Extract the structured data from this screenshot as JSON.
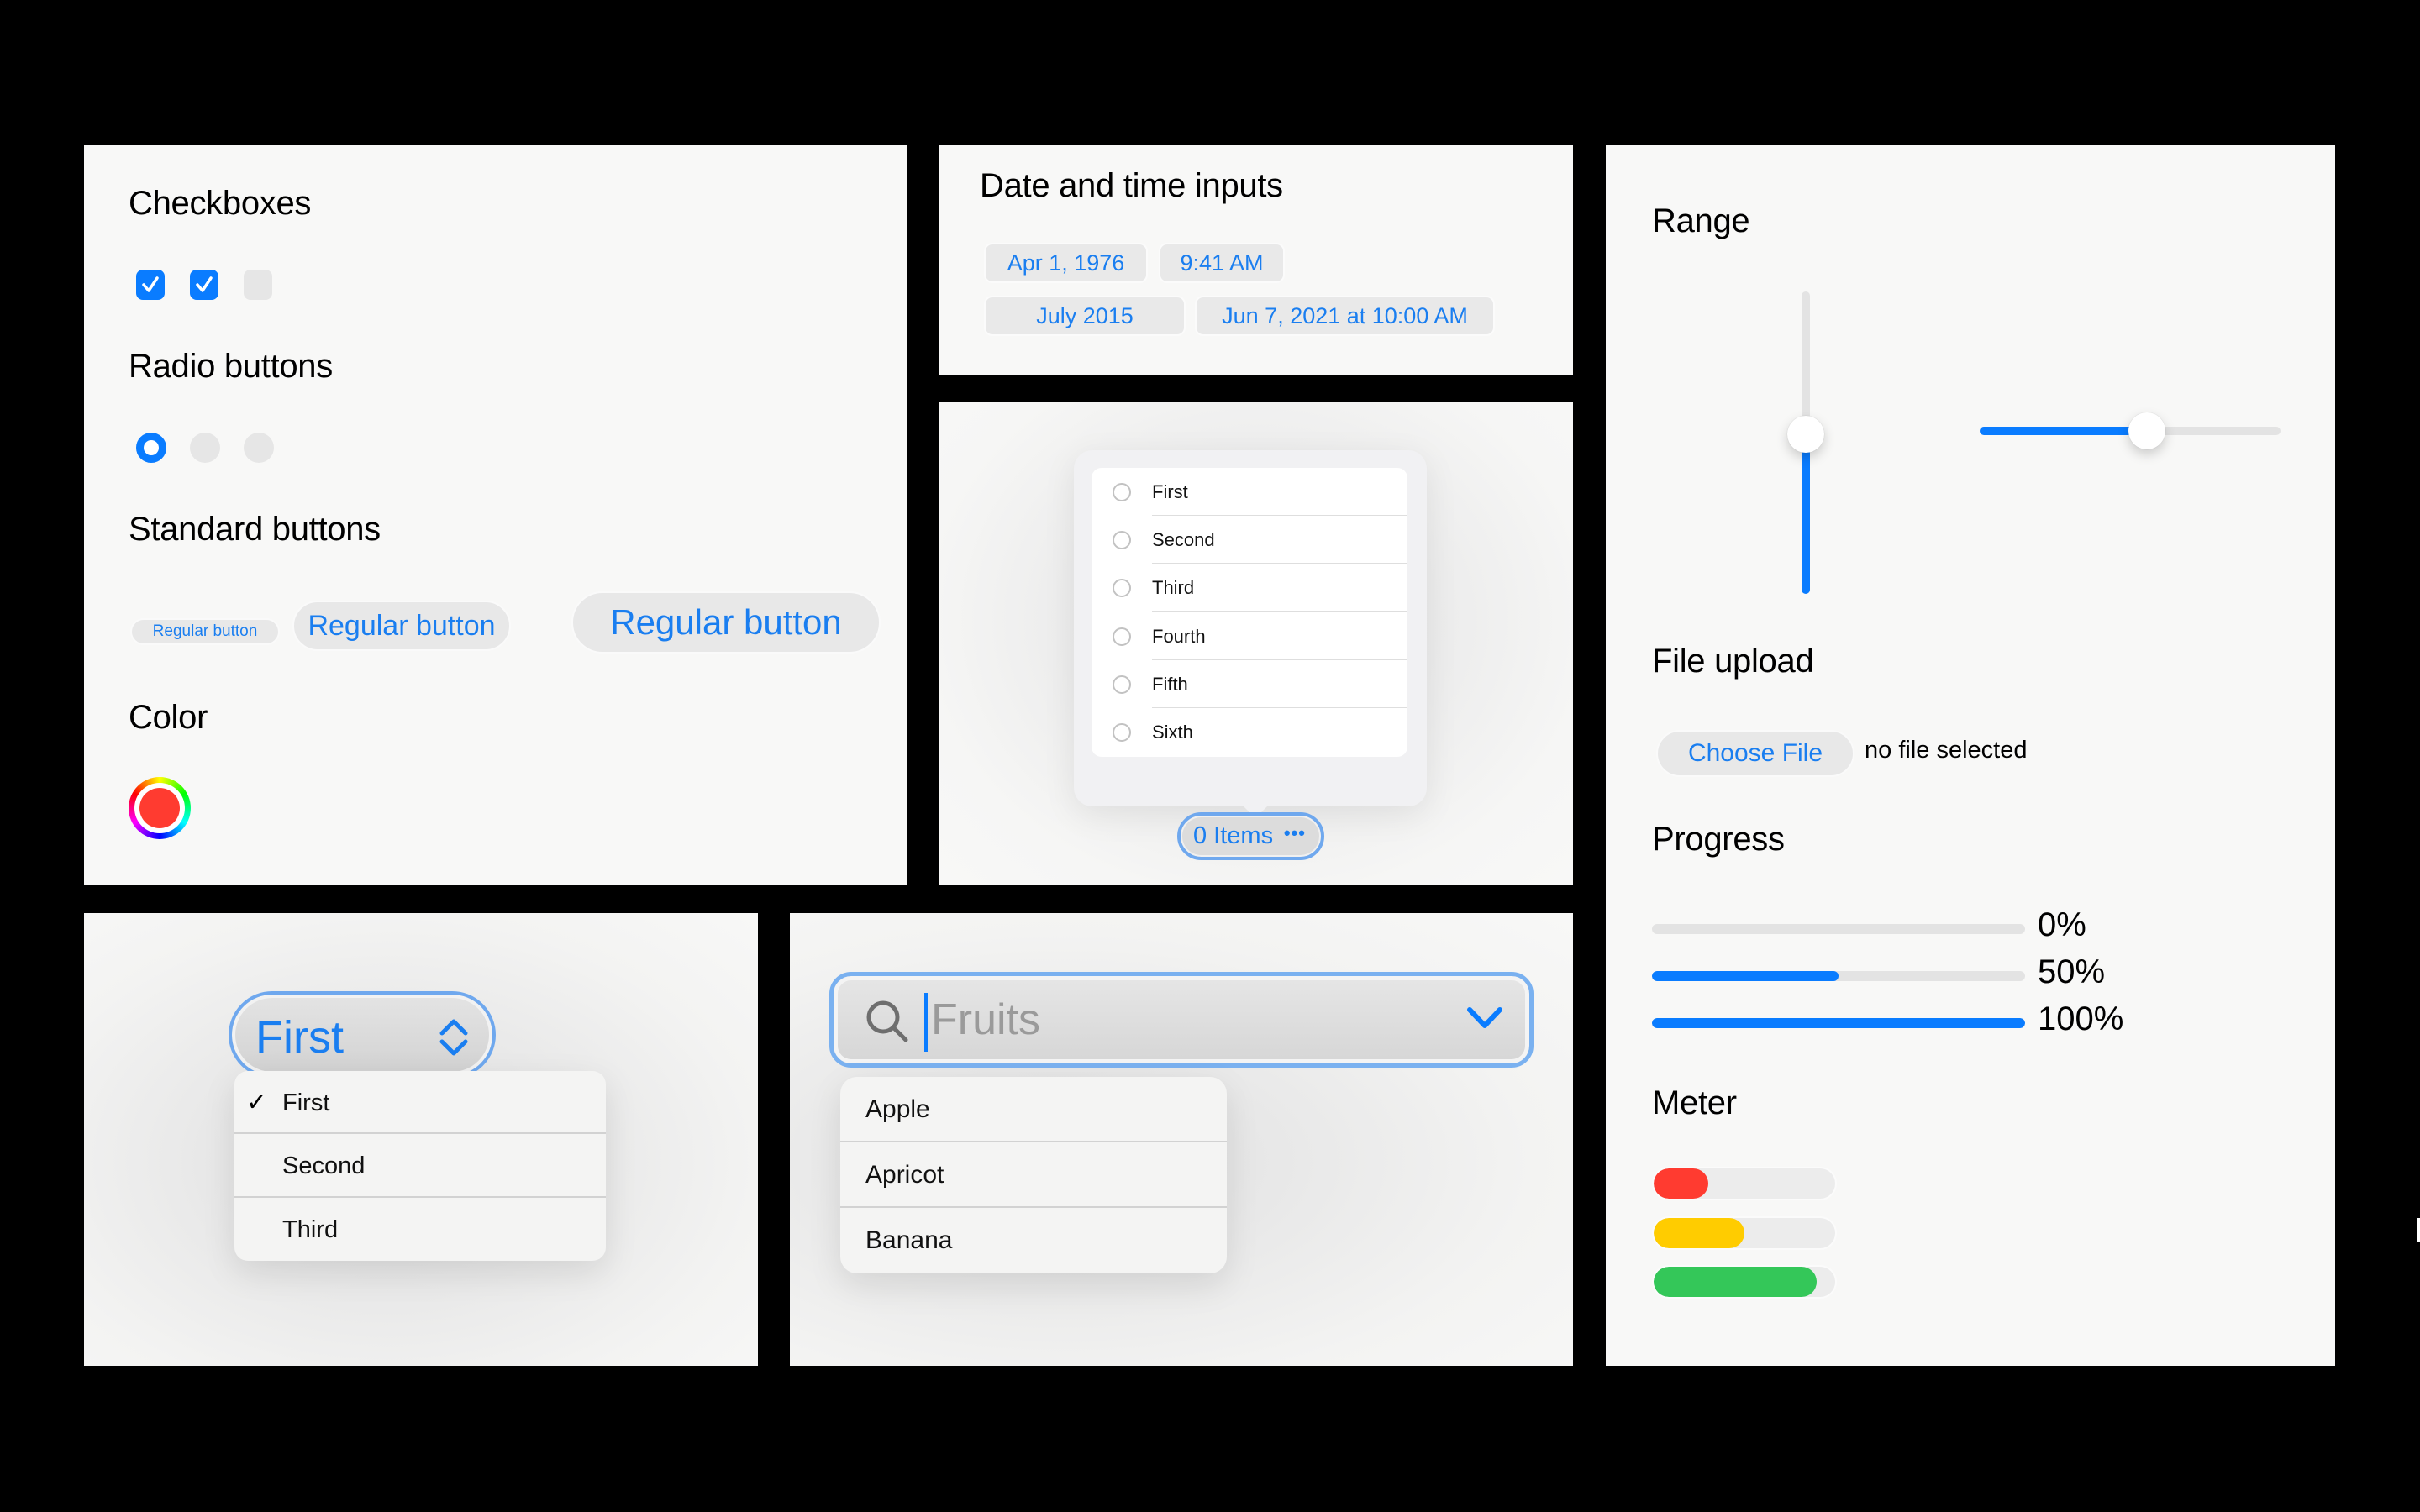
{
  "colors": {
    "accent": "#0a7cff",
    "accent_text": "#1a7ef0",
    "panel_bg": "#f8f8f7",
    "backdrop": "#000000",
    "track": "#e3e3e3",
    "meter_low": "#ff3b30",
    "meter_mid": "#ffcc00",
    "meter_high": "#34c759",
    "color_value": "#ff3b30"
  },
  "controls_panel": {
    "checkboxes": {
      "heading": "Checkboxes",
      "items": [
        {
          "checked": true
        },
        {
          "checked": true
        },
        {
          "checked": false
        }
      ]
    },
    "radios": {
      "heading": "Radio buttons",
      "items": [
        {
          "selected": true
        },
        {
          "selected": false
        },
        {
          "selected": false
        }
      ]
    },
    "buttons": {
      "heading": "Standard buttons",
      "items": [
        {
          "label": "Regular button",
          "size": "small"
        },
        {
          "label": "Regular button",
          "size": "regular"
        },
        {
          "label": "Regular button",
          "size": "large"
        }
      ]
    },
    "color": {
      "heading": "Color",
      "value": "#ff3b30",
      "icon": "color-wheel-icon"
    }
  },
  "date_panel": {
    "heading": "Date and time inputs",
    "inputs": [
      {
        "type": "date",
        "value": "Apr 1, 1976"
      },
      {
        "type": "time",
        "value": "9:41 AM"
      },
      {
        "type": "month",
        "value": "July 2015"
      },
      {
        "type": "datetime-local",
        "value": "Jun 7, 2021 at 10:00 AM"
      }
    ]
  },
  "multiselect_panel": {
    "options": [
      {
        "label": "First",
        "selected": false
      },
      {
        "label": "Second",
        "selected": false
      },
      {
        "label": "Third",
        "selected": false
      },
      {
        "label": "Fourth",
        "selected": false
      },
      {
        "label": "Fifth",
        "selected": false
      },
      {
        "label": "Sixth",
        "selected": false
      }
    ],
    "button_label": "0 Items",
    "more_icon": "ellipsis-icon",
    "more_glyph": "•••"
  },
  "right_panel": {
    "range": {
      "heading": "Range",
      "vertical_value": 0.5,
      "horizontal_value": 0.5
    },
    "file_upload": {
      "heading": "File upload",
      "button_label": "Choose File",
      "status": "no file selected"
    },
    "progress": {
      "heading": "Progress",
      "bars": [
        {
          "value": 0,
          "label": "0%"
        },
        {
          "value": 0.5,
          "label": "50%"
        },
        {
          "value": 1,
          "label": "100%"
        }
      ]
    },
    "meter": {
      "heading": "Meter",
      "bars": [
        {
          "value": 0.3,
          "level": "low"
        },
        {
          "value": 0.5,
          "level": "mid"
        },
        {
          "value": 0.9,
          "level": "high"
        }
      ]
    }
  },
  "select_panel": {
    "selected": "First",
    "options": [
      {
        "label": "First",
        "checked": true,
        "check_glyph": "✓"
      },
      {
        "label": "Second",
        "checked": false,
        "check_glyph": ""
      },
      {
        "label": "Third",
        "checked": false,
        "check_glyph": ""
      }
    ],
    "icon": "chevron-up-down-icon"
  },
  "combobox_panel": {
    "placeholder": "Fruits",
    "value": "",
    "search_icon": "search-icon",
    "dropdown_icon": "chevron-down-icon",
    "options": [
      "Apple",
      "Apricot",
      "Banana"
    ]
  }
}
